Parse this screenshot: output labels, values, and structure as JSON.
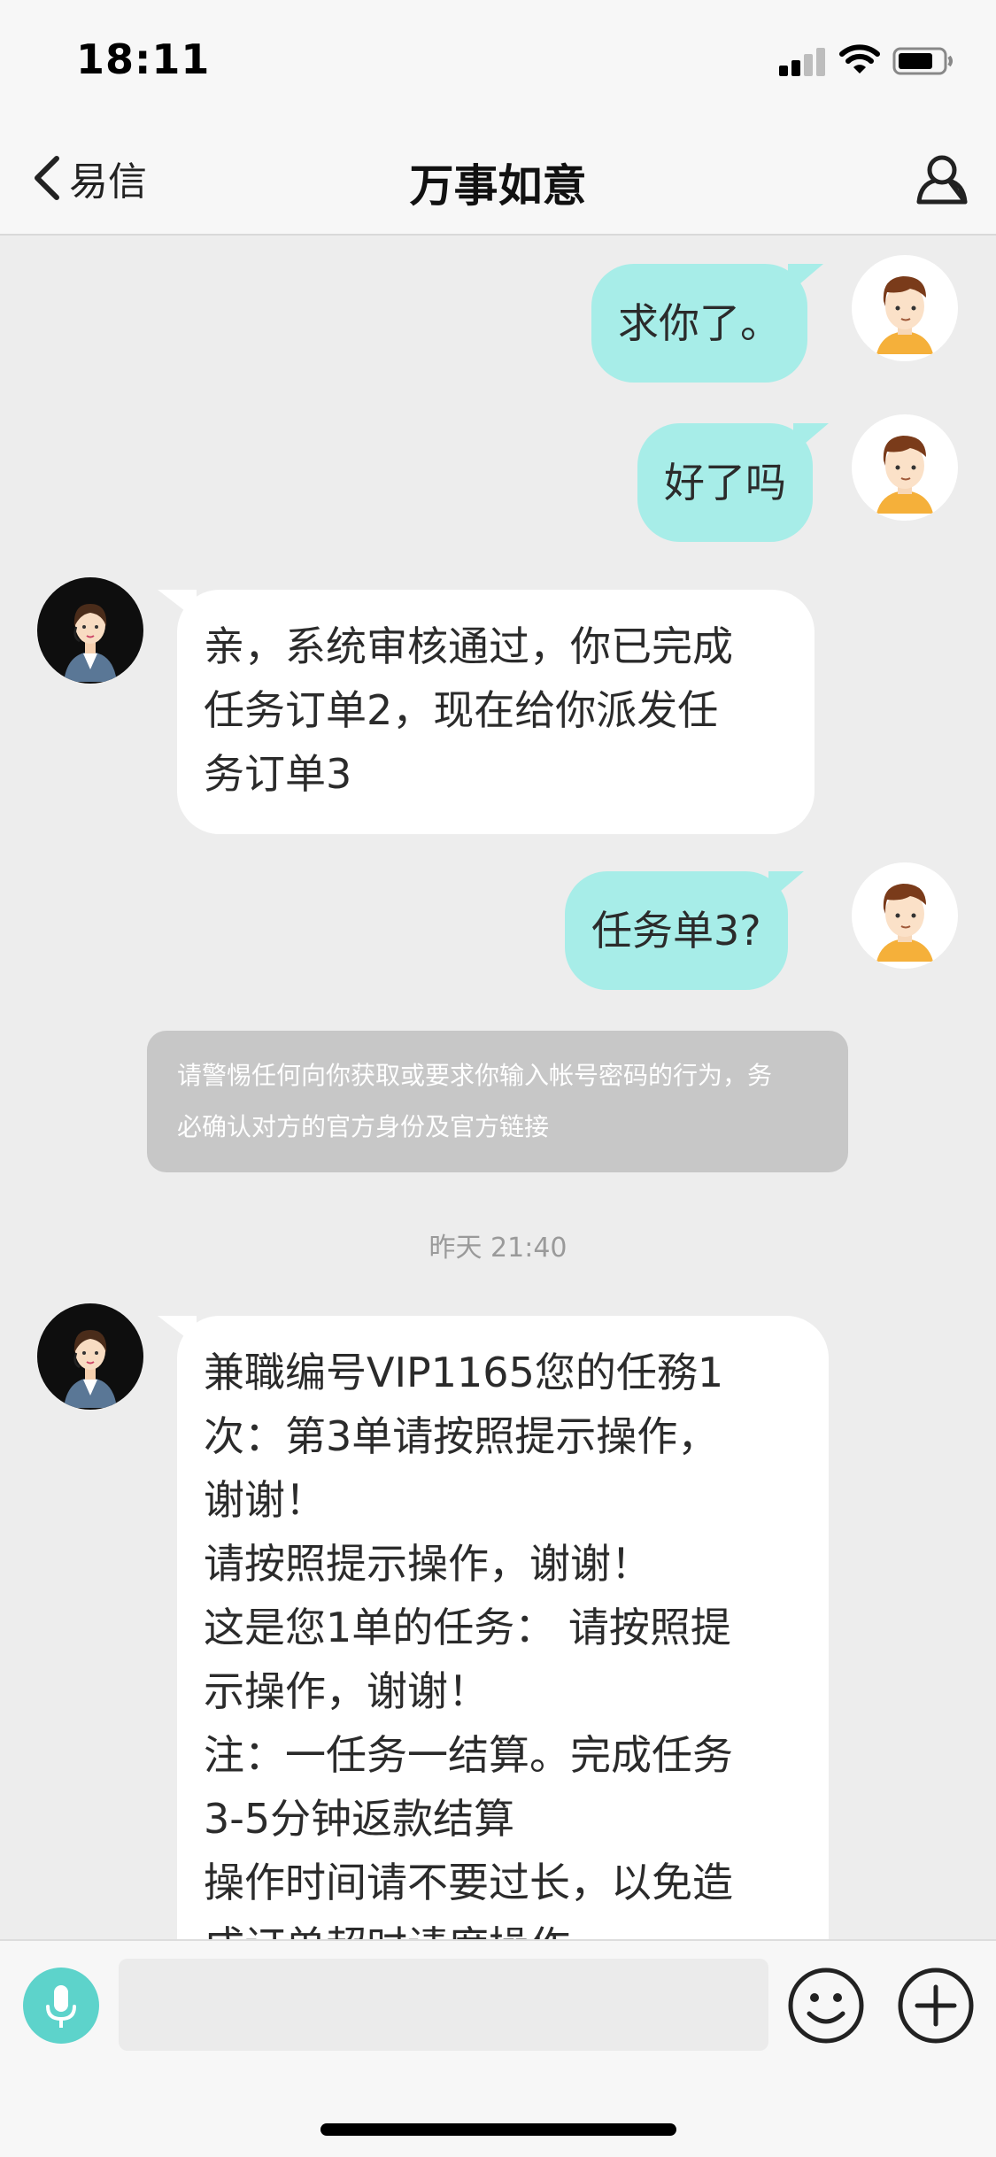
{
  "status_bar": {
    "time": "18:11"
  },
  "nav": {
    "back_label": "易信",
    "title": "万事如意"
  },
  "messages": [
    {
      "from": "me",
      "lines": [
        "求你了。"
      ]
    },
    {
      "from": "me",
      "lines": [
        "好了吗"
      ]
    },
    {
      "from": "agent",
      "lines": [
        "亲，系统审核通过，你已完成",
        "任务订单2，现在给你派发任",
        "务订单3"
      ]
    },
    {
      "from": "me",
      "lines": [
        "任务单3?"
      ]
    },
    {
      "from": "agent",
      "lines": [
        "兼職编号VIP1165您的任務1",
        "次：第3单请按照提示操作，",
        "谢谢！",
        "请按照提示操作，谢谢！",
        "这是您1单的任务：   请按照提",
        "示操作，谢谢！",
        "注：一任务一结算。完成任务",
        "3-5分钟返款结算",
        "操作时间请不要过长，以免造",
        "成订单超时请度操作"
      ]
    }
  ],
  "notice": {
    "lines": [
      "请警惕任何向你获取或要求你输入帐号密码的行为，务",
      "必确认对方的官方身份及官方链接"
    ]
  },
  "timestamp": "昨天 21:40",
  "input": {
    "value": "",
    "placeholder": ""
  },
  "colors": {
    "outgoing_bubble": "#a7ede8",
    "incoming_bubble": "#ffffff",
    "accent": "#5dd3cb",
    "background": "#ededed"
  },
  "icons": [
    "back-chevron-icon",
    "profile-icon",
    "microphone-icon",
    "emoji-icon",
    "plus-icon",
    "signal-icon",
    "wifi-icon",
    "battery-icon"
  ]
}
